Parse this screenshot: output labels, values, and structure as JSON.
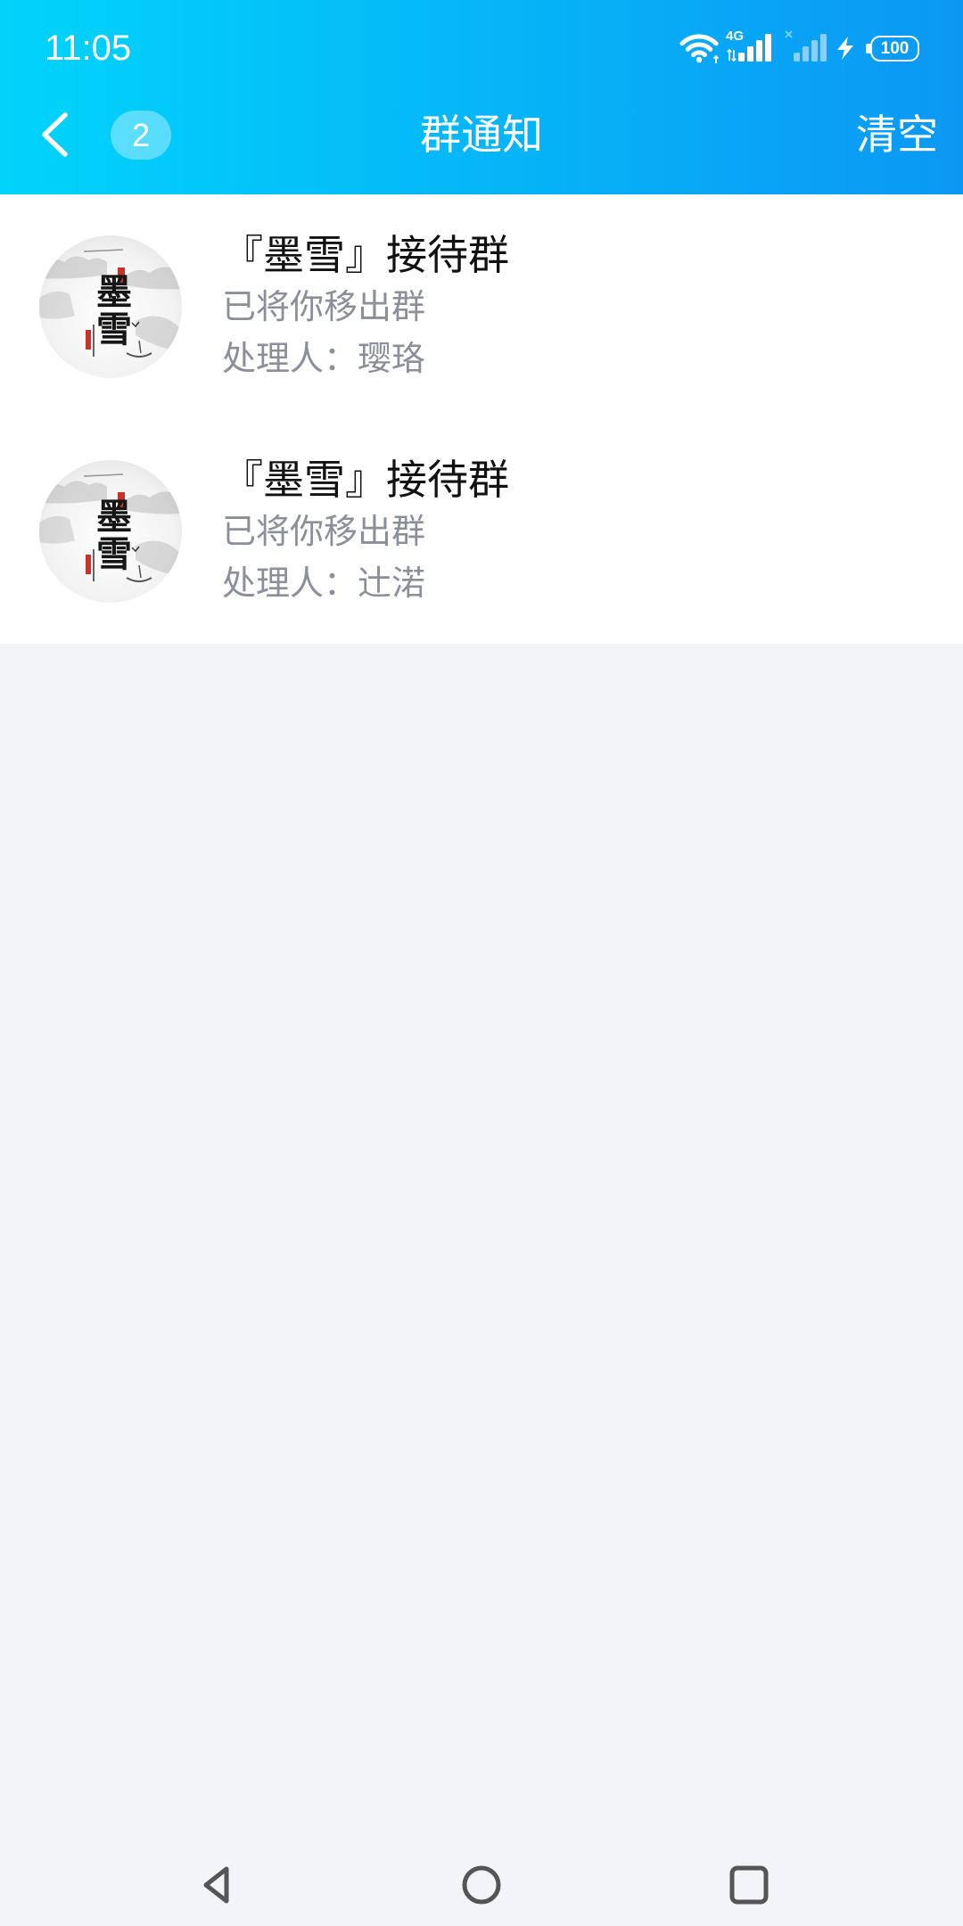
{
  "status_bar": {
    "time": "11:05",
    "network_type": "4G",
    "battery_level": "100",
    "icons": {
      "wifi": "wifi-icon",
      "sim1": "signal-icon",
      "sim2": "signal-off-icon",
      "charging": "charging-icon",
      "battery": "battery-icon"
    }
  },
  "header": {
    "back_icon": "chevron-left-icon",
    "badge_count": "2",
    "title": "群通知",
    "clear_label": "清空"
  },
  "notifications": [
    {
      "group_name": "『墨雪』接待群",
      "message": "已将你移出群",
      "handler": "处理人：璎珞",
      "avatar_text": "墨雪"
    },
    {
      "group_name": "『墨雪』接待群",
      "message": "已将你移出群",
      "handler": "处理人：辻渃",
      "avatar_text": "墨雪"
    }
  ],
  "system_nav": {
    "icons": [
      "triangle-back-icon",
      "circle-home-icon",
      "square-recents-icon"
    ]
  },
  "colors": {
    "header_gradient_start": "#00d4fb",
    "header_gradient_end": "#0b98f4",
    "badge_background": "#ffffff59",
    "title_text": "#111111",
    "secondary_text": "#8a8f99",
    "list_background": "#ffffff",
    "page_background": "#f3f4f8",
    "nav_icon": "#555555"
  }
}
